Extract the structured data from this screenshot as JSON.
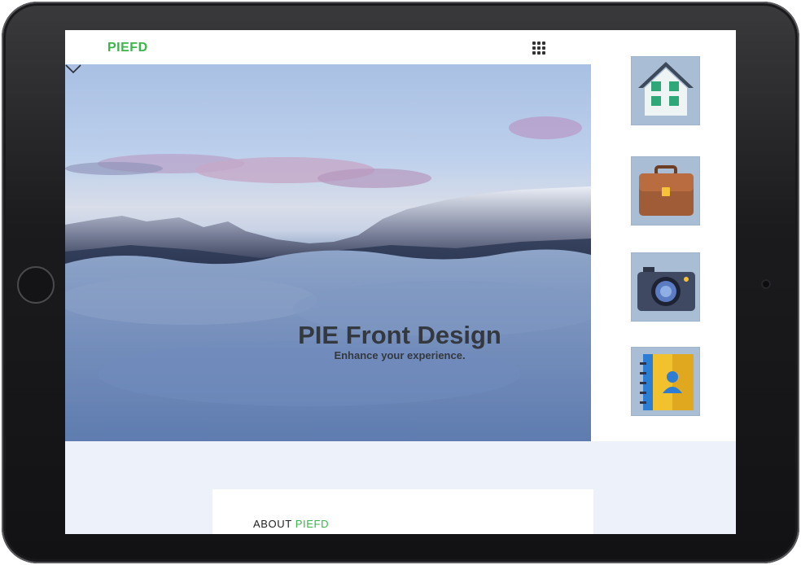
{
  "header": {
    "logo": "PIEFD",
    "menu_icon": "grid-icon"
  },
  "hero": {
    "title": "PIE Front Design",
    "subtitle": "Enhance your experience.",
    "scroll_icon": "chevron-down-icon"
  },
  "side_apps": [
    {
      "name": "home",
      "icon": "home-icon"
    },
    {
      "name": "work",
      "icon": "briefcase-icon"
    },
    {
      "name": "camera",
      "icon": "camera-icon"
    },
    {
      "name": "contacts",
      "icon": "contacts-book-icon"
    }
  ],
  "about": {
    "label": "ABOUT",
    "brand": "PIEFD"
  },
  "colors": {
    "brand_green": "#3ab54a",
    "tile_bg": "#a9bdd4",
    "lower_bg": "#edf1f9",
    "bezel": "#1b1b1d"
  }
}
